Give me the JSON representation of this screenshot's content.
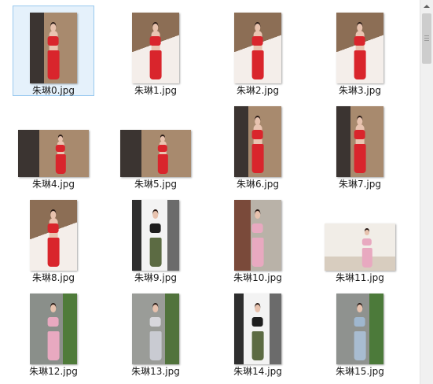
{
  "files": [
    {
      "name": "朱琳0.jpg",
      "selected": true,
      "orientation": "portrait",
      "scene": "bath-red"
    },
    {
      "name": "朱琳1.jpg",
      "selected": false,
      "orientation": "portrait",
      "scene": "tub-red"
    },
    {
      "name": "朱琳2.jpg",
      "selected": false,
      "orientation": "portrait",
      "scene": "tub-red"
    },
    {
      "name": "朱琳3.jpg",
      "selected": false,
      "orientation": "portrait",
      "scene": "tub-red"
    },
    {
      "name": "朱琳4.jpg",
      "selected": false,
      "orientation": "landscape",
      "scene": "bath-red"
    },
    {
      "name": "朱琳5.jpg",
      "selected": false,
      "orientation": "landscape",
      "scene": "bath-red"
    },
    {
      "name": "朱琳6.jpg",
      "selected": false,
      "orientation": "portrait",
      "scene": "bath-red"
    },
    {
      "name": "朱琳7.jpg",
      "selected": false,
      "orientation": "portrait",
      "scene": "bath-red"
    },
    {
      "name": "朱琳8.jpg",
      "selected": false,
      "orientation": "portrait",
      "scene": "tub-red"
    },
    {
      "name": "朱琳9.jpg",
      "selected": false,
      "orientation": "portrait",
      "scene": "street-camo"
    },
    {
      "name": "朱琳10.jpg",
      "selected": false,
      "orientation": "portrait",
      "scene": "brick-pink"
    },
    {
      "name": "朱琳11.jpg",
      "selected": false,
      "orientation": "landscape",
      "scene": "room-pink"
    },
    {
      "name": "朱琳12.jpg",
      "selected": false,
      "orientation": "portrait",
      "scene": "wall-pink"
    },
    {
      "name": "朱琳13.jpg",
      "selected": false,
      "orientation": "portrait",
      "scene": "wall-grey"
    },
    {
      "name": "朱琳14.jpg",
      "selected": false,
      "orientation": "portrait",
      "scene": "street-camo"
    },
    {
      "name": "朱琳15.jpg",
      "selected": false,
      "orientation": "portrait",
      "scene": "wall-blue"
    }
  ],
  "colors": {
    "selection_fill": "#e5f1fb",
    "selection_border": "#99c9ef",
    "bikini_red": "#d9252c",
    "dress_pink": "#e8a9c0",
    "camo_green": "#5c6b43"
  }
}
